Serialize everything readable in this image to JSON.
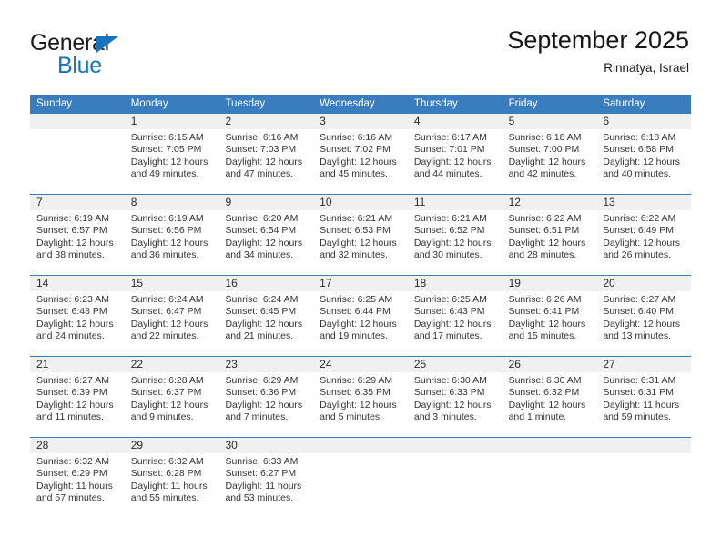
{
  "brand": {
    "name_top": "General",
    "name_bottom": "Blue"
  },
  "header": {
    "title": "September 2025",
    "subtitle": "Rinnatya, Israel"
  },
  "colors": {
    "header_blue": "#3a7dbf",
    "brand_blue": "#1673bd",
    "day_band_gray": "#f0f0f0",
    "text": "#333333"
  },
  "calendar": {
    "day_headers": [
      "Sunday",
      "Monday",
      "Tuesday",
      "Wednesday",
      "Thursday",
      "Friday",
      "Saturday"
    ],
    "weeks": [
      [
        {
          "day": "",
          "sunrise": "",
          "sunset": "",
          "daylight_line1": "",
          "daylight_line2": ""
        },
        {
          "day": "1",
          "sunrise": "Sunrise: 6:15 AM",
          "sunset": "Sunset: 7:05 PM",
          "daylight_line1": "Daylight: 12 hours",
          "daylight_line2": "and 49 minutes."
        },
        {
          "day": "2",
          "sunrise": "Sunrise: 6:16 AM",
          "sunset": "Sunset: 7:03 PM",
          "daylight_line1": "Daylight: 12 hours",
          "daylight_line2": "and 47 minutes."
        },
        {
          "day": "3",
          "sunrise": "Sunrise: 6:16 AM",
          "sunset": "Sunset: 7:02 PM",
          "daylight_line1": "Daylight: 12 hours",
          "daylight_line2": "and 45 minutes."
        },
        {
          "day": "4",
          "sunrise": "Sunrise: 6:17 AM",
          "sunset": "Sunset: 7:01 PM",
          "daylight_line1": "Daylight: 12 hours",
          "daylight_line2": "and 44 minutes."
        },
        {
          "day": "5",
          "sunrise": "Sunrise: 6:18 AM",
          "sunset": "Sunset: 7:00 PM",
          "daylight_line1": "Daylight: 12 hours",
          "daylight_line2": "and 42 minutes."
        },
        {
          "day": "6",
          "sunrise": "Sunrise: 6:18 AM",
          "sunset": "Sunset: 6:58 PM",
          "daylight_line1": "Daylight: 12 hours",
          "daylight_line2": "and 40 minutes."
        }
      ],
      [
        {
          "day": "7",
          "sunrise": "Sunrise: 6:19 AM",
          "sunset": "Sunset: 6:57 PM",
          "daylight_line1": "Daylight: 12 hours",
          "daylight_line2": "and 38 minutes."
        },
        {
          "day": "8",
          "sunrise": "Sunrise: 6:19 AM",
          "sunset": "Sunset: 6:56 PM",
          "daylight_line1": "Daylight: 12 hours",
          "daylight_line2": "and 36 minutes."
        },
        {
          "day": "9",
          "sunrise": "Sunrise: 6:20 AM",
          "sunset": "Sunset: 6:54 PM",
          "daylight_line1": "Daylight: 12 hours",
          "daylight_line2": "and 34 minutes."
        },
        {
          "day": "10",
          "sunrise": "Sunrise: 6:21 AM",
          "sunset": "Sunset: 6:53 PM",
          "daylight_line1": "Daylight: 12 hours",
          "daylight_line2": "and 32 minutes."
        },
        {
          "day": "11",
          "sunrise": "Sunrise: 6:21 AM",
          "sunset": "Sunset: 6:52 PM",
          "daylight_line1": "Daylight: 12 hours",
          "daylight_line2": "and 30 minutes."
        },
        {
          "day": "12",
          "sunrise": "Sunrise: 6:22 AM",
          "sunset": "Sunset: 6:51 PM",
          "daylight_line1": "Daylight: 12 hours",
          "daylight_line2": "and 28 minutes."
        },
        {
          "day": "13",
          "sunrise": "Sunrise: 6:22 AM",
          "sunset": "Sunset: 6:49 PM",
          "daylight_line1": "Daylight: 12 hours",
          "daylight_line2": "and 26 minutes."
        }
      ],
      [
        {
          "day": "14",
          "sunrise": "Sunrise: 6:23 AM",
          "sunset": "Sunset: 6:48 PM",
          "daylight_line1": "Daylight: 12 hours",
          "daylight_line2": "and 24 minutes."
        },
        {
          "day": "15",
          "sunrise": "Sunrise: 6:24 AM",
          "sunset": "Sunset: 6:47 PM",
          "daylight_line1": "Daylight: 12 hours",
          "daylight_line2": "and 22 minutes."
        },
        {
          "day": "16",
          "sunrise": "Sunrise: 6:24 AM",
          "sunset": "Sunset: 6:45 PM",
          "daylight_line1": "Daylight: 12 hours",
          "daylight_line2": "and 21 minutes."
        },
        {
          "day": "17",
          "sunrise": "Sunrise: 6:25 AM",
          "sunset": "Sunset: 6:44 PM",
          "daylight_line1": "Daylight: 12 hours",
          "daylight_line2": "and 19 minutes."
        },
        {
          "day": "18",
          "sunrise": "Sunrise: 6:25 AM",
          "sunset": "Sunset: 6:43 PM",
          "daylight_line1": "Daylight: 12 hours",
          "daylight_line2": "and 17 minutes."
        },
        {
          "day": "19",
          "sunrise": "Sunrise: 6:26 AM",
          "sunset": "Sunset: 6:41 PM",
          "daylight_line1": "Daylight: 12 hours",
          "daylight_line2": "and 15 minutes."
        },
        {
          "day": "20",
          "sunrise": "Sunrise: 6:27 AM",
          "sunset": "Sunset: 6:40 PM",
          "daylight_line1": "Daylight: 12 hours",
          "daylight_line2": "and 13 minutes."
        }
      ],
      [
        {
          "day": "21",
          "sunrise": "Sunrise: 6:27 AM",
          "sunset": "Sunset: 6:39 PM",
          "daylight_line1": "Daylight: 12 hours",
          "daylight_line2": "and 11 minutes."
        },
        {
          "day": "22",
          "sunrise": "Sunrise: 6:28 AM",
          "sunset": "Sunset: 6:37 PM",
          "daylight_line1": "Daylight: 12 hours",
          "daylight_line2": "and 9 minutes."
        },
        {
          "day": "23",
          "sunrise": "Sunrise: 6:29 AM",
          "sunset": "Sunset: 6:36 PM",
          "daylight_line1": "Daylight: 12 hours",
          "daylight_line2": "and 7 minutes."
        },
        {
          "day": "24",
          "sunrise": "Sunrise: 6:29 AM",
          "sunset": "Sunset: 6:35 PM",
          "daylight_line1": "Daylight: 12 hours",
          "daylight_line2": "and 5 minutes."
        },
        {
          "day": "25",
          "sunrise": "Sunrise: 6:30 AM",
          "sunset": "Sunset: 6:33 PM",
          "daylight_line1": "Daylight: 12 hours",
          "daylight_line2": "and 3 minutes."
        },
        {
          "day": "26",
          "sunrise": "Sunrise: 6:30 AM",
          "sunset": "Sunset: 6:32 PM",
          "daylight_line1": "Daylight: 12 hours",
          "daylight_line2": "and 1 minute."
        },
        {
          "day": "27",
          "sunrise": "Sunrise: 6:31 AM",
          "sunset": "Sunset: 6:31 PM",
          "daylight_line1": "Daylight: 11 hours",
          "daylight_line2": "and 59 minutes."
        }
      ],
      [
        {
          "day": "28",
          "sunrise": "Sunrise: 6:32 AM",
          "sunset": "Sunset: 6:29 PM",
          "daylight_line1": "Daylight: 11 hours",
          "daylight_line2": "and 57 minutes."
        },
        {
          "day": "29",
          "sunrise": "Sunrise: 6:32 AM",
          "sunset": "Sunset: 6:28 PM",
          "daylight_line1": "Daylight: 11 hours",
          "daylight_line2": "and 55 minutes."
        },
        {
          "day": "30",
          "sunrise": "Sunrise: 6:33 AM",
          "sunset": "Sunset: 6:27 PM",
          "daylight_line1": "Daylight: 11 hours",
          "daylight_line2": "and 53 minutes."
        },
        {
          "day": "",
          "sunrise": "",
          "sunset": "",
          "daylight_line1": "",
          "daylight_line2": ""
        },
        {
          "day": "",
          "sunrise": "",
          "sunset": "",
          "daylight_line1": "",
          "daylight_line2": ""
        },
        {
          "day": "",
          "sunrise": "",
          "sunset": "",
          "daylight_line1": "",
          "daylight_line2": ""
        },
        {
          "day": "",
          "sunrise": "",
          "sunset": "",
          "daylight_line1": "",
          "daylight_line2": ""
        }
      ]
    ]
  }
}
